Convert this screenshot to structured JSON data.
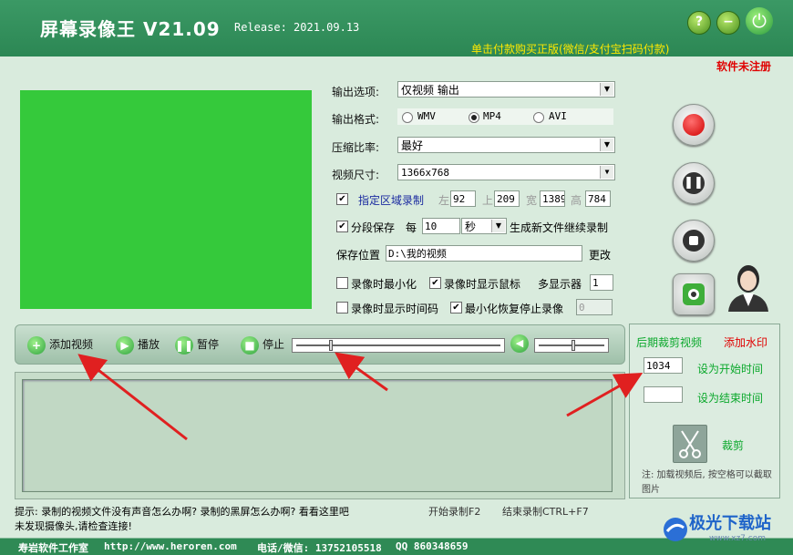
{
  "header": {
    "title": "屏幕录像王 V21.09",
    "release": "Release: 2021.09.13",
    "help": "?",
    "min": "−",
    "buy": "单击付款购买正版(微信/支付宝扫码付款)",
    "unregistered": "软件未注册"
  },
  "settings": {
    "output_option_label": "输出选项:",
    "output_option_value": "仅视频 输出",
    "output_format_label": "输出格式:",
    "formats": [
      "WMV",
      "MP4",
      "AVI"
    ],
    "compression_label": "压缩比率:",
    "compression_value": "最好",
    "size_label": "视频尺寸:",
    "size_value": "1366x768",
    "region_label": "指定区域录制",
    "left_label": "左",
    "left_value": "92",
    "top_label": "上",
    "top_value": "209",
    "width_label": "宽",
    "width_value": "1389",
    "height_label": "高",
    "height_value": "784",
    "segment_label": "分段保存",
    "every_label": "每",
    "every_value": "10",
    "unit_value": "秒",
    "segment_suffix": "生成新文件继续录制",
    "save_label": "保存位置",
    "save_path": "D:\\我的视频",
    "change": "更改",
    "min_on_record": "录像时最小化",
    "show_cursor": "录像时显示鼠标",
    "multi_monitor_label": "多显示器",
    "multi_monitor_value": "1",
    "show_timecode": "录像时显示时间码",
    "restore_stop": "最小化恢复停止录像",
    "restore_value": "0"
  },
  "toolbar": {
    "add": "添加视频",
    "play": "播放",
    "pause": "暂停",
    "stop": "停止"
  },
  "trim": {
    "title": "后期裁剪视频",
    "watermark": "添加水印",
    "start_value": "1034",
    "set_start": "设为开始时间",
    "set_end": "设为结束时间",
    "cut": "裁剪",
    "note": "注: 加载视频后, 按空格可以截取图片"
  },
  "status": {
    "tip": "提示: 录制的视频文件没有声音怎么办啊? 录制的黑屏怎么办啊? 看看这里吧",
    "start_key": "开始录制F2",
    "end_key": "结束录制CTRL+F7",
    "camera": "未发现摄像头,请检查连接!"
  },
  "footer": {
    "studio": "寿岩软件工作室",
    "url": "http://www.heroren.com",
    "phone": "电话/微信: 13752105518",
    "qq": "QQ 860348659",
    "watermark": "极光下载站",
    "watermark_url": "www.xz7.com"
  },
  "colors": {
    "accent": "#2e8a55",
    "preview": "#35c93b",
    "warning": "#e00000",
    "highlight": "#0aa82b"
  }
}
